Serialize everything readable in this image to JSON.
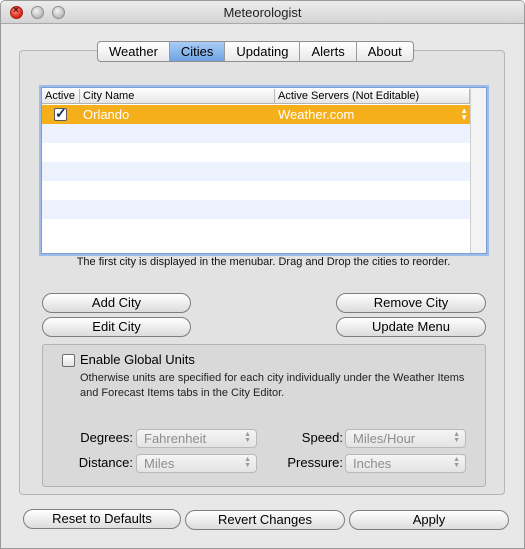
{
  "window": {
    "title": "Meteorologist"
  },
  "tabs": [
    {
      "label": "Weather",
      "selected": false
    },
    {
      "label": "Cities",
      "selected": true
    },
    {
      "label": "Updating",
      "selected": false
    },
    {
      "label": "Alerts",
      "selected": false
    },
    {
      "label": "About",
      "selected": false
    }
  ],
  "table": {
    "columns": {
      "active": "Active",
      "city": "City Name",
      "servers": "Active Servers (Not Editable)"
    },
    "rows": [
      {
        "active": true,
        "city": "Orlando",
        "servers": "Weather.com"
      }
    ],
    "selection_color": "#f4af1b"
  },
  "hint": "The first city is displayed in the menubar.  Drag and Drop the cities to reorder.",
  "buttons": {
    "add_city": "Add City",
    "edit_city": "Edit City",
    "remove_city": "Remove City",
    "update_menu": "Update Menu",
    "reset": "Reset to Defaults",
    "revert": "Revert Changes",
    "apply": "Apply"
  },
  "units": {
    "enable_label": "Enable Global Units",
    "enabled": false,
    "note": "Otherwise units are specified for each city individually under the Weather Items and Forecast Items tabs in the City Editor.",
    "degrees_label": "Degrees:",
    "degrees_value": "Fahrenheit",
    "distance_label": "Distance:",
    "distance_value": "Miles",
    "speed_label": "Speed:",
    "speed_value": "Miles/Hour",
    "pressure_label": "Pressure:",
    "pressure_value": "Inches"
  }
}
